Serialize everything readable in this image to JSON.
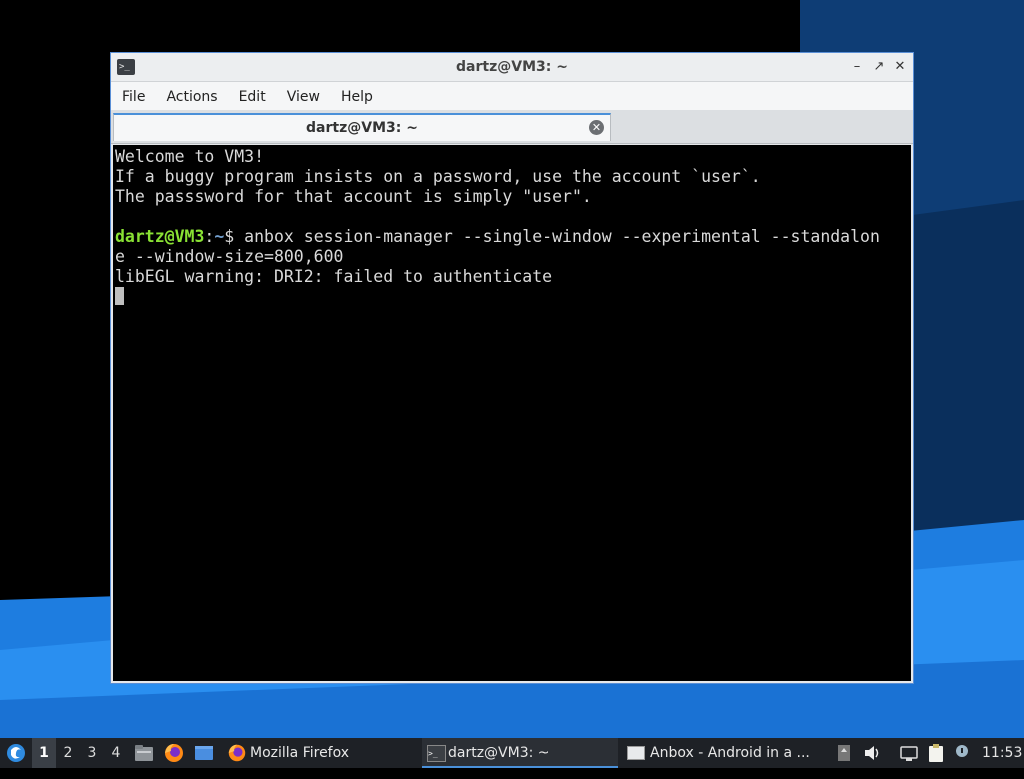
{
  "window": {
    "title": "dartz@VM3: ~",
    "menu": [
      "File",
      "Actions",
      "Edit",
      "View",
      "Help"
    ],
    "tab_label": "dartz@VM3: ~"
  },
  "terminal": {
    "lines": [
      "Welcome to VM3!",
      "If a buggy program insists on a password, use the account `user`.",
      "The passsword for that account is simply \"user\".",
      ""
    ],
    "prompt_user": "dartz@VM3",
    "prompt_sep": ":",
    "prompt_path": "~",
    "prompt_symbol": "$ ",
    "command_line1": "anbox session-manager --single-window --experimental --standalon",
    "command_line2": "e --window-size=800,600",
    "output": "libEGL warning: DRI2: failed to authenticate"
  },
  "taskbar": {
    "workspaces": [
      "1",
      "2",
      "3",
      "4"
    ],
    "active_workspace": "1",
    "tasks": [
      {
        "label": "Mozilla Firefox",
        "icon": "firefox-icon"
      },
      {
        "label": "dartz@VM3: ~",
        "icon": "terminal-icon"
      },
      {
        "label": "Anbox - Android in a ...",
        "icon": "window-icon"
      }
    ],
    "clock": "11:53"
  },
  "colors": {
    "accent": "#4a90d9",
    "prompt_user": "#8ae234",
    "prompt_path": "#729fcf",
    "wallpaper_blue": "#0a64c8"
  }
}
